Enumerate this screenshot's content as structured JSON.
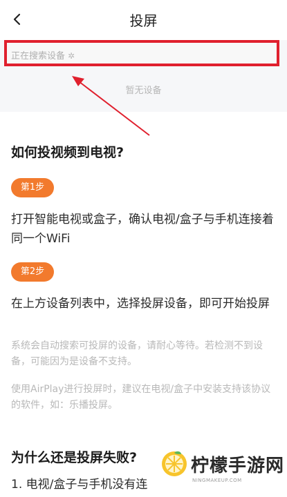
{
  "header": {
    "title": "投屏"
  },
  "search": {
    "status_text": "正在搜索设备",
    "empty_text": "暂无设备"
  },
  "help": {
    "title": "如何投视频到电视?",
    "step1_label": "第1步",
    "step1_text": "打开智能电视或盒子，确认电视/盒子与手机连接着同一个WiFi",
    "step2_label": "第2步",
    "step2_text": "在上方设备列表中，选择投屏设备，即可开始投屏",
    "note1": "系统会自动搜索可投屏的设备，请耐心等待。若检测不到设备，可能因为是设备不支持。",
    "note2": "使用AirPlay进行投屏时，建议在电视/盒子中安装支持该协议的软件，如：乐播投屏。"
  },
  "faq": {
    "title": "为什么还是投屏失败?",
    "item1": "1. 电视/盒子与手机没有连"
  },
  "watermark": {
    "brand": "柠檬手游网",
    "url": "NINGMAKEUP.COM"
  },
  "colors": {
    "accent_orange": "#f27a2d",
    "highlight_red": "#e0202e"
  }
}
